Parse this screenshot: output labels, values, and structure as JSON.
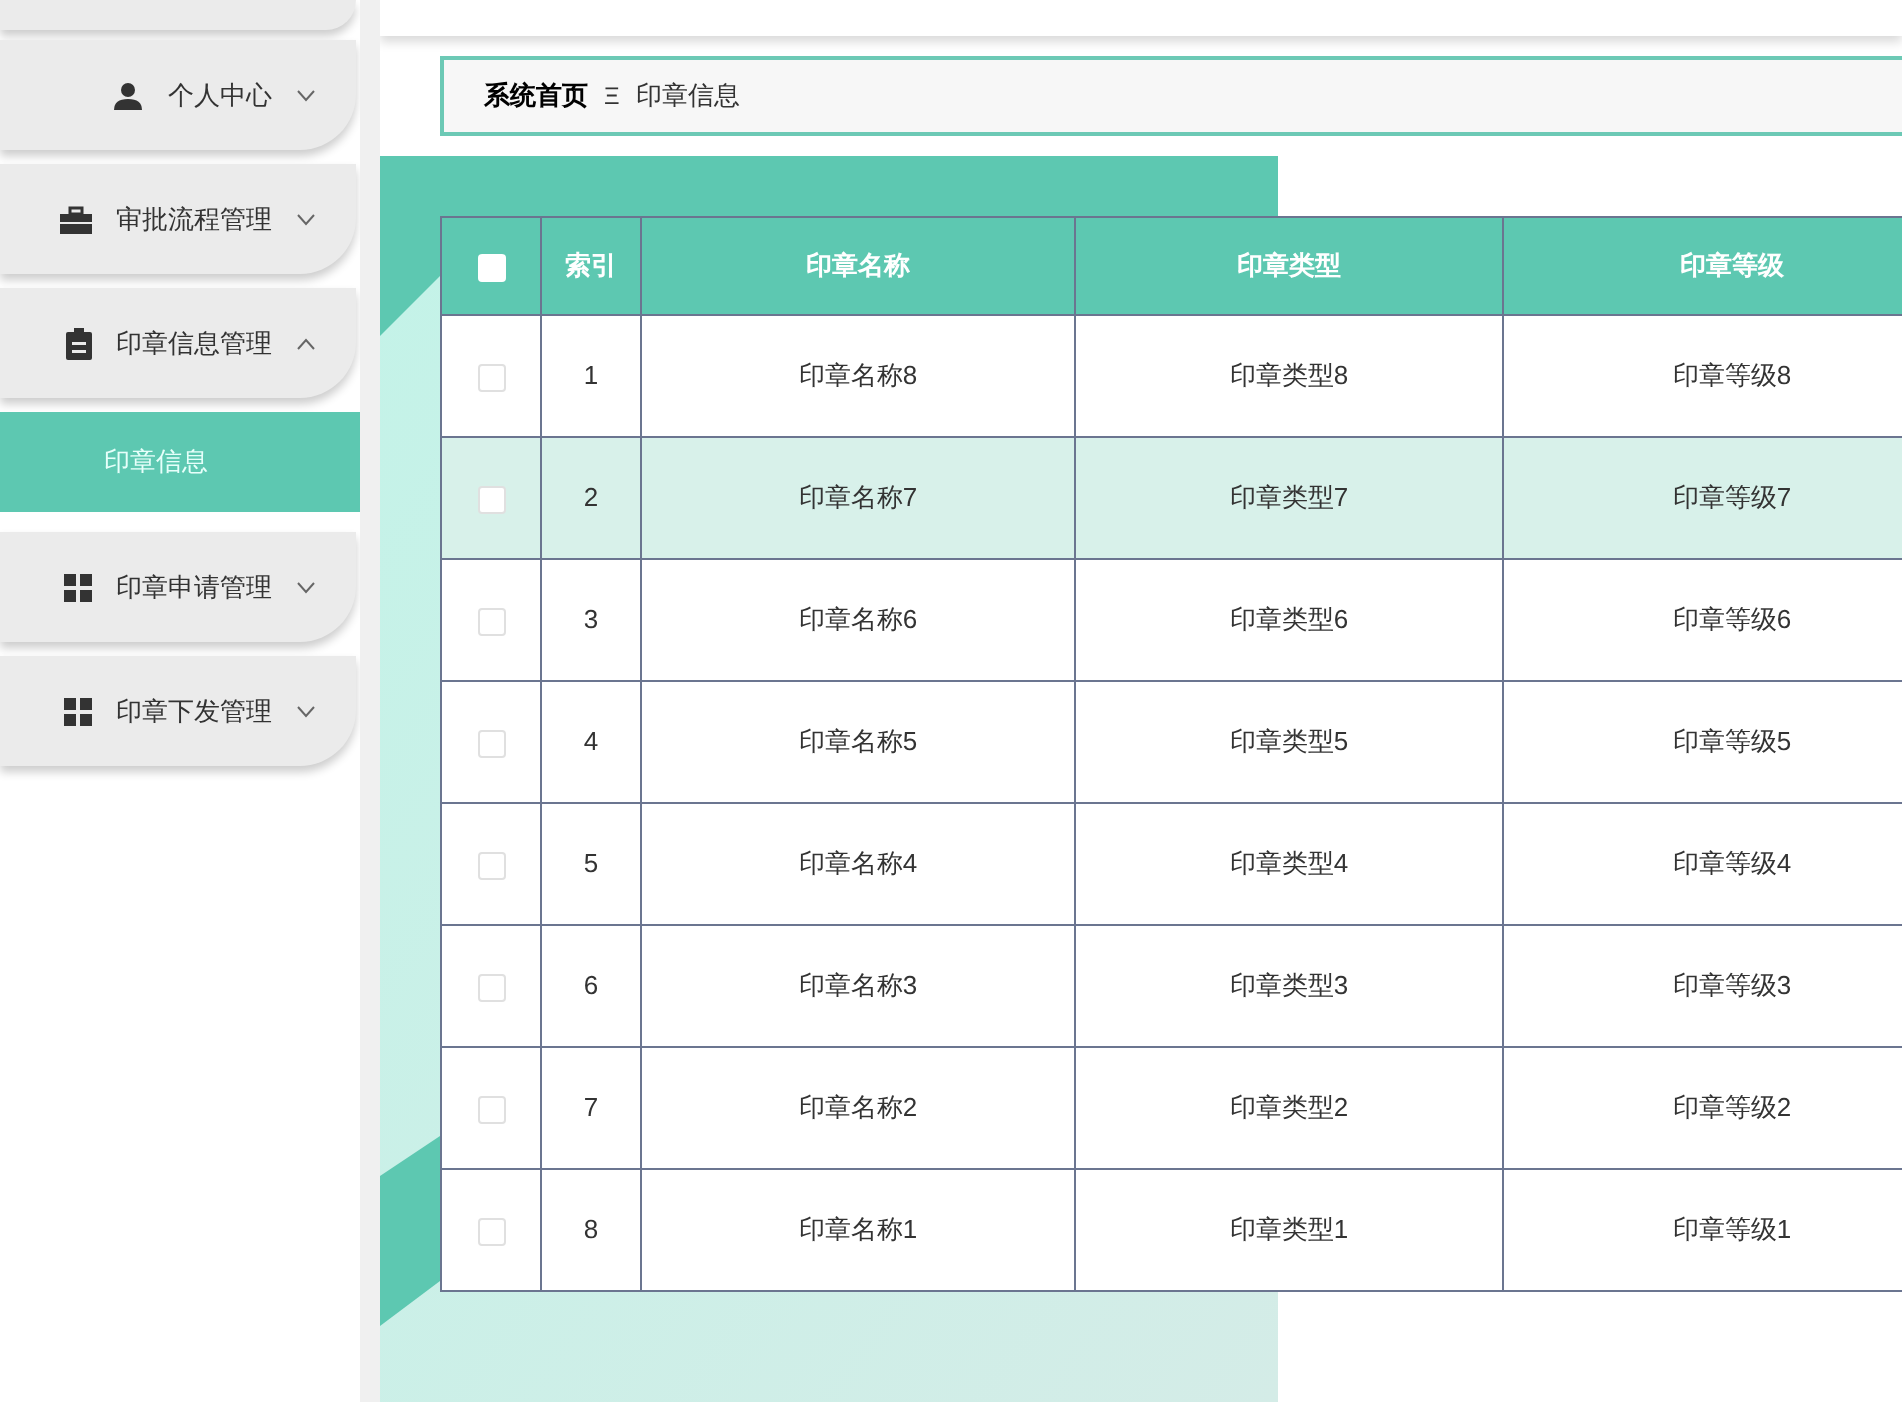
{
  "sidebar": {
    "items": [
      {
        "label": "个人中心",
        "kind": "person",
        "expanded": false
      },
      {
        "label": "审批流程管理",
        "kind": "briefcase",
        "expanded": false
      },
      {
        "label": "印章信息管理",
        "kind": "clipboard",
        "expanded": true,
        "children": [
          {
            "label": "印章信息",
            "selected": true
          }
        ]
      },
      {
        "label": "印章申请管理",
        "kind": "grid",
        "expanded": false
      },
      {
        "label": "印章下发管理",
        "kind": "grid",
        "expanded": false
      }
    ]
  },
  "breadcrumb": {
    "home": "系统首页",
    "separator": "Ξ",
    "current": "印章信息"
  },
  "table": {
    "select_all_checked": false,
    "columns": [
      "索引",
      "印章名称",
      "印章类型",
      "印章等级"
    ],
    "rows": [
      {
        "checked": false,
        "highlighted": false,
        "cells": [
          "1",
          "印章名称8",
          "印章类型8",
          "印章等级8"
        ]
      },
      {
        "checked": false,
        "highlighted": true,
        "cells": [
          "2",
          "印章名称7",
          "印章类型7",
          "印章等级7"
        ]
      },
      {
        "checked": false,
        "highlighted": false,
        "cells": [
          "3",
          "印章名称6",
          "印章类型6",
          "印章等级6"
        ]
      },
      {
        "checked": false,
        "highlighted": false,
        "cells": [
          "4",
          "印章名称5",
          "印章类型5",
          "印章等级5"
        ]
      },
      {
        "checked": false,
        "highlighted": false,
        "cells": [
          "5",
          "印章名称4",
          "印章类型4",
          "印章等级4"
        ]
      },
      {
        "checked": false,
        "highlighted": false,
        "cells": [
          "6",
          "印章名称3",
          "印章类型3",
          "印章等级3"
        ]
      },
      {
        "checked": false,
        "highlighted": false,
        "cells": [
          "7",
          "印章名称2",
          "印章类型2",
          "印章等级2"
        ]
      },
      {
        "checked": false,
        "highlighted": false,
        "cells": [
          "8",
          "印章名称1",
          "印章类型1",
          "印章等级1"
        ]
      }
    ]
  }
}
